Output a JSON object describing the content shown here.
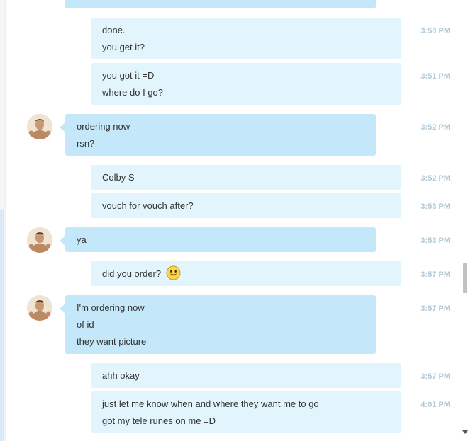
{
  "messages": [
    {
      "side": "out",
      "lines": [
        "done.",
        "you get it?"
      ],
      "time": "3:50 PM"
    },
    {
      "side": "out",
      "lines": [
        "you got it =D",
        "where do I go?"
      ],
      "time": "3:51 PM"
    },
    {
      "side": "in",
      "lines": [
        "ordering now",
        "rsn?"
      ],
      "time": "3:52 PM"
    },
    {
      "side": "out",
      "lines": [
        "Colby S"
      ],
      "time": "3:52 PM"
    },
    {
      "side": "out",
      "lines": [
        "vouch for vouch after?"
      ],
      "time": "3:53 PM"
    },
    {
      "side": "in",
      "lines": [
        "ya"
      ],
      "time": "3:53 PM"
    },
    {
      "side": "out",
      "lines": [
        "did you order?"
      ],
      "time": "3:57 PM",
      "emoticon": "smile-emoticon"
    },
    {
      "side": "in",
      "lines": [
        "I'm ordering now",
        "of id",
        "they want picture"
      ],
      "time": "3:57 PM"
    },
    {
      "side": "out",
      "lines": [
        "ahh okay"
      ],
      "time": "3:57 PM"
    },
    {
      "side": "out",
      "lines": [
        "just let me know when and where they want me to go",
        "got my tele runes on me =D"
      ],
      "time": "4:01 PM"
    }
  ],
  "colors": {
    "outgoing_bubble": "#e2f4fc",
    "incoming_bubble": "#c4e8f9",
    "timestamp": "#b3c9d6",
    "text": "#333333"
  },
  "icons": {
    "avatar": "contact-avatar-photo",
    "emoticon": "smile-emoticon"
  }
}
